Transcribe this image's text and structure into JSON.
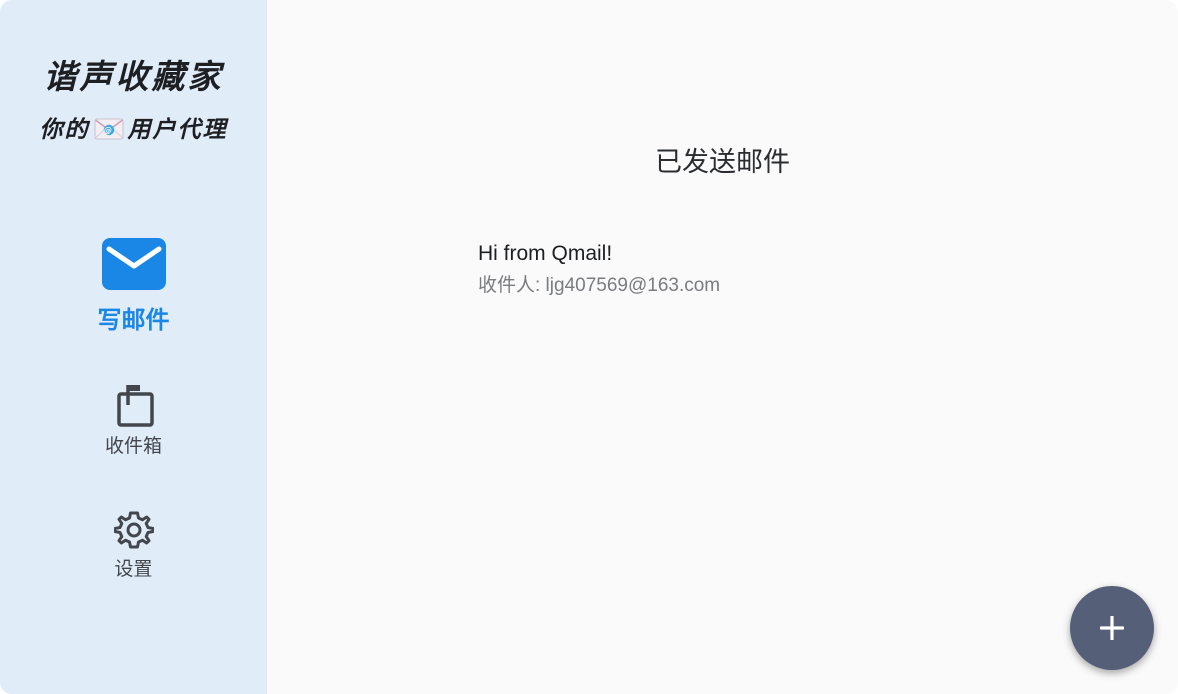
{
  "sidebar": {
    "app_title": "谐声收藏家",
    "subtitle_prefix": "你的",
    "subtitle_icon": "envelope-emoji-icon",
    "subtitle_suffix": "用户代理",
    "items": [
      {
        "label": "写邮件",
        "icon": "mail-icon",
        "active": true
      },
      {
        "label": "收件箱",
        "icon": "mailbox-icon",
        "active": false
      },
      {
        "label": "设置",
        "icon": "gear-icon",
        "active": false
      }
    ]
  },
  "main": {
    "title": "已发送邮件",
    "mails": [
      {
        "subject": "Hi from Qmail!",
        "recipient": "收件人: ljg407569@163.com"
      }
    ]
  },
  "fab": {
    "icon": "plus-icon"
  },
  "colors": {
    "sidebar_bg": "#e1ecf9",
    "accent": "#1a86e6",
    "fab_bg": "#565f78",
    "main_bg": "#fafafa"
  }
}
